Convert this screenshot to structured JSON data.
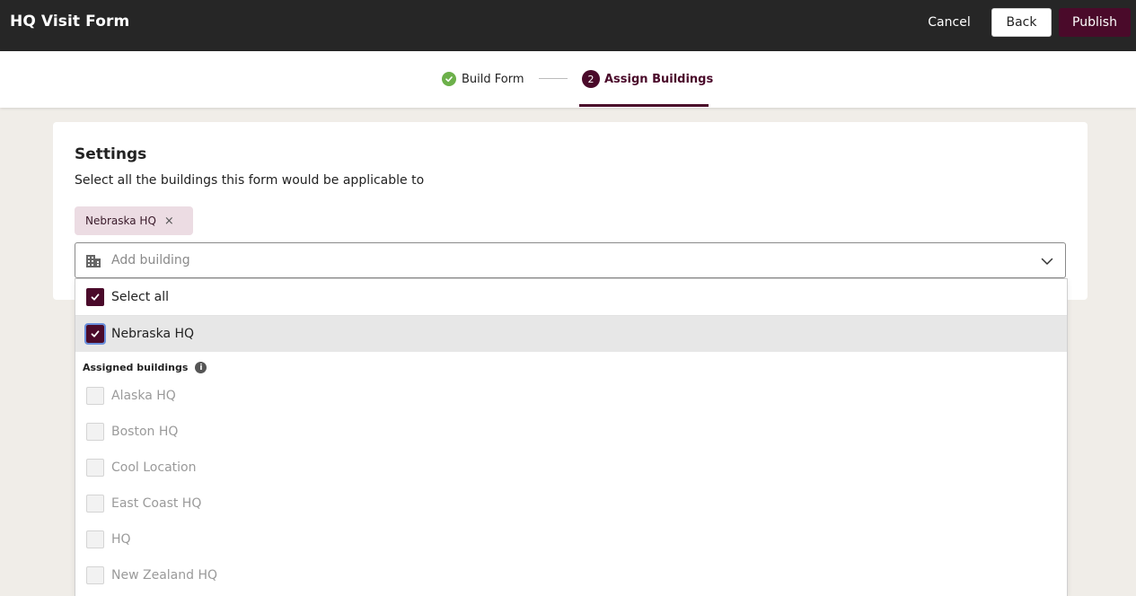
{
  "header": {
    "title": "HQ Visit Form",
    "cancel_label": "Cancel",
    "back_label": "Back",
    "publish_label": "Publish"
  },
  "steps": [
    {
      "label": "Build Form",
      "state": "complete"
    },
    {
      "number": "2",
      "label": "Assign Buildings",
      "state": "active"
    }
  ],
  "settings": {
    "heading": "Settings",
    "description": "Select all the buildings this form would be applicable to",
    "selected_chips": [
      "Nebraska HQ"
    ],
    "chip_remove_glyph": "×",
    "search_placeholder": "Add building"
  },
  "dropdown": {
    "select_all_label": "Select all",
    "select_all_checked": true,
    "checked_options": [
      {
        "label": "Nebraska HQ",
        "checked": true
      }
    ],
    "assigned_heading": "Assigned buildings",
    "info_glyph": "i",
    "assigned_options": [
      {
        "label": "Alaska HQ",
        "disabled": true
      },
      {
        "label": "Boston HQ",
        "disabled": true
      },
      {
        "label": "Cool Location",
        "disabled": true
      },
      {
        "label": "East Coast HQ",
        "disabled": true
      },
      {
        "label": "HQ",
        "disabled": true
      },
      {
        "label": "New Zealand HQ",
        "disabled": true
      }
    ]
  },
  "colors": {
    "topbar_bg": "#262626",
    "brand": "#4a0a2a",
    "complete_green": "#6cb04a",
    "chip_bg": "#ecdce3",
    "page_bg": "#f0ede8"
  }
}
